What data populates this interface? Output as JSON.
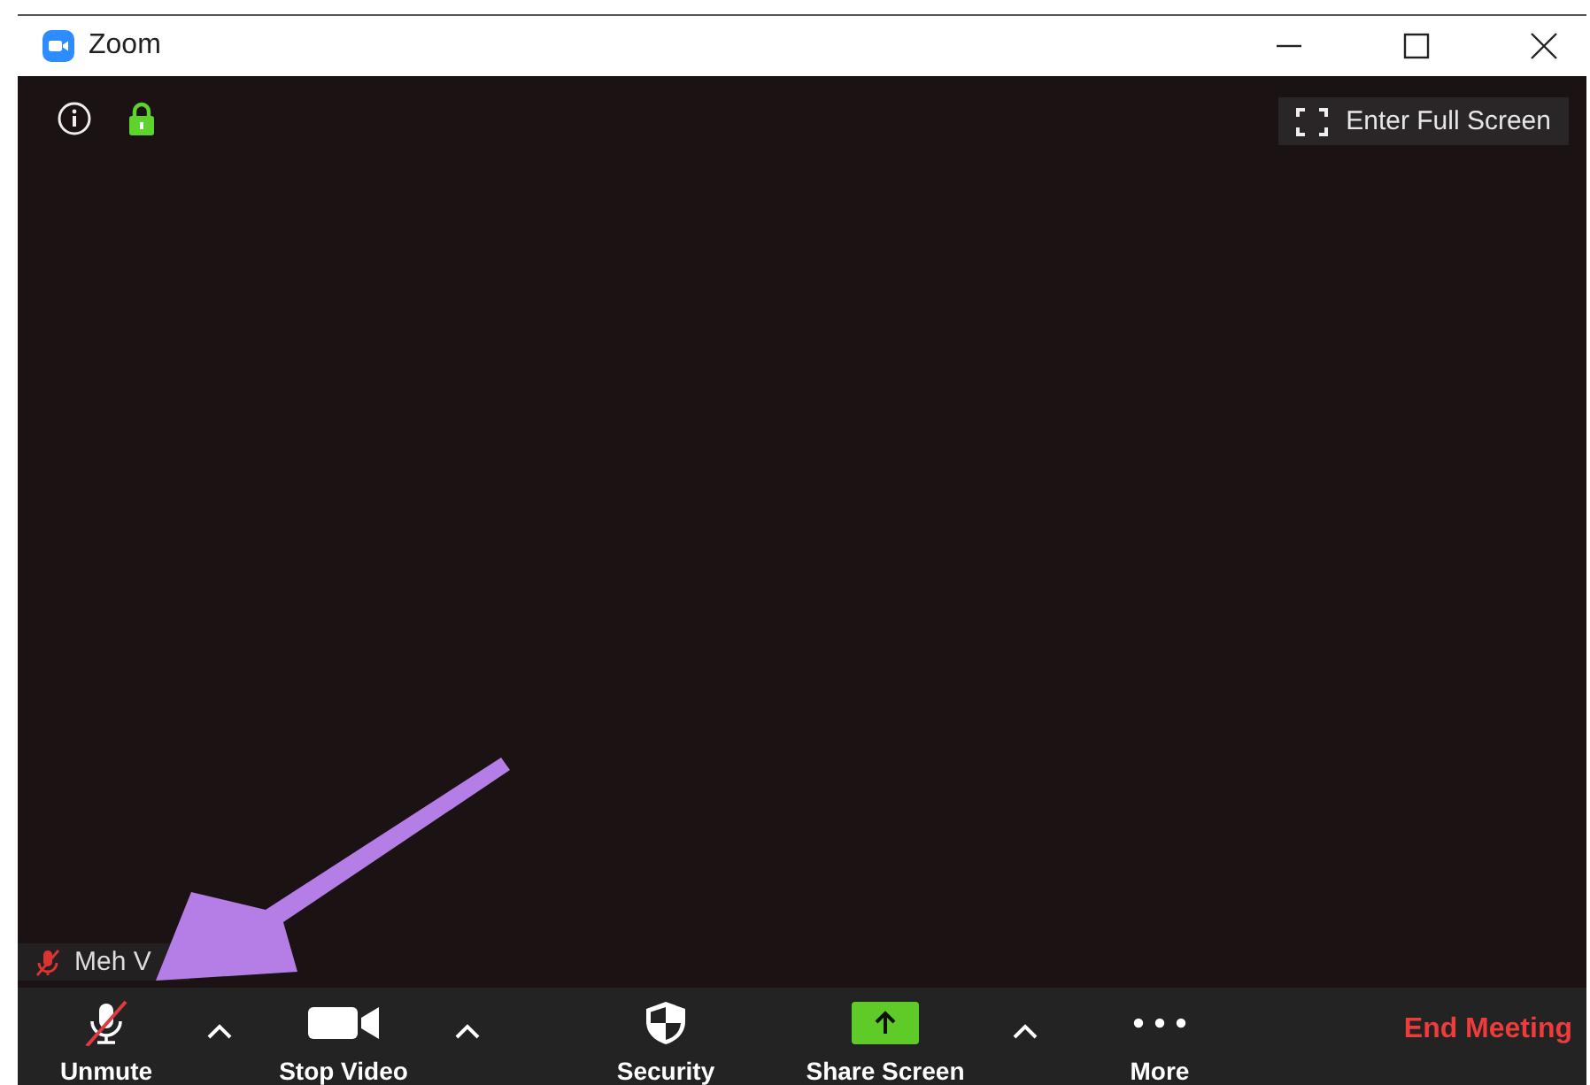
{
  "window": {
    "title": "Zoom"
  },
  "meeting": {
    "encrypted": true,
    "fullscreen_button": "Enter Full Screen"
  },
  "participant": {
    "name": "Meh V",
    "muted": true
  },
  "toolbar": [
    {
      "kind": "mic",
      "label": "Unmute",
      "muted": true
    },
    {
      "kind": "caret"
    },
    {
      "kind": "video",
      "label": "Stop Video"
    },
    {
      "kind": "caret"
    },
    {
      "kind": "security",
      "label": "Security"
    },
    {
      "kind": "share",
      "label": "Share Screen"
    },
    {
      "kind": "caret"
    },
    {
      "kind": "more",
      "label": "More"
    }
  ],
  "end_button": "End Meeting"
}
